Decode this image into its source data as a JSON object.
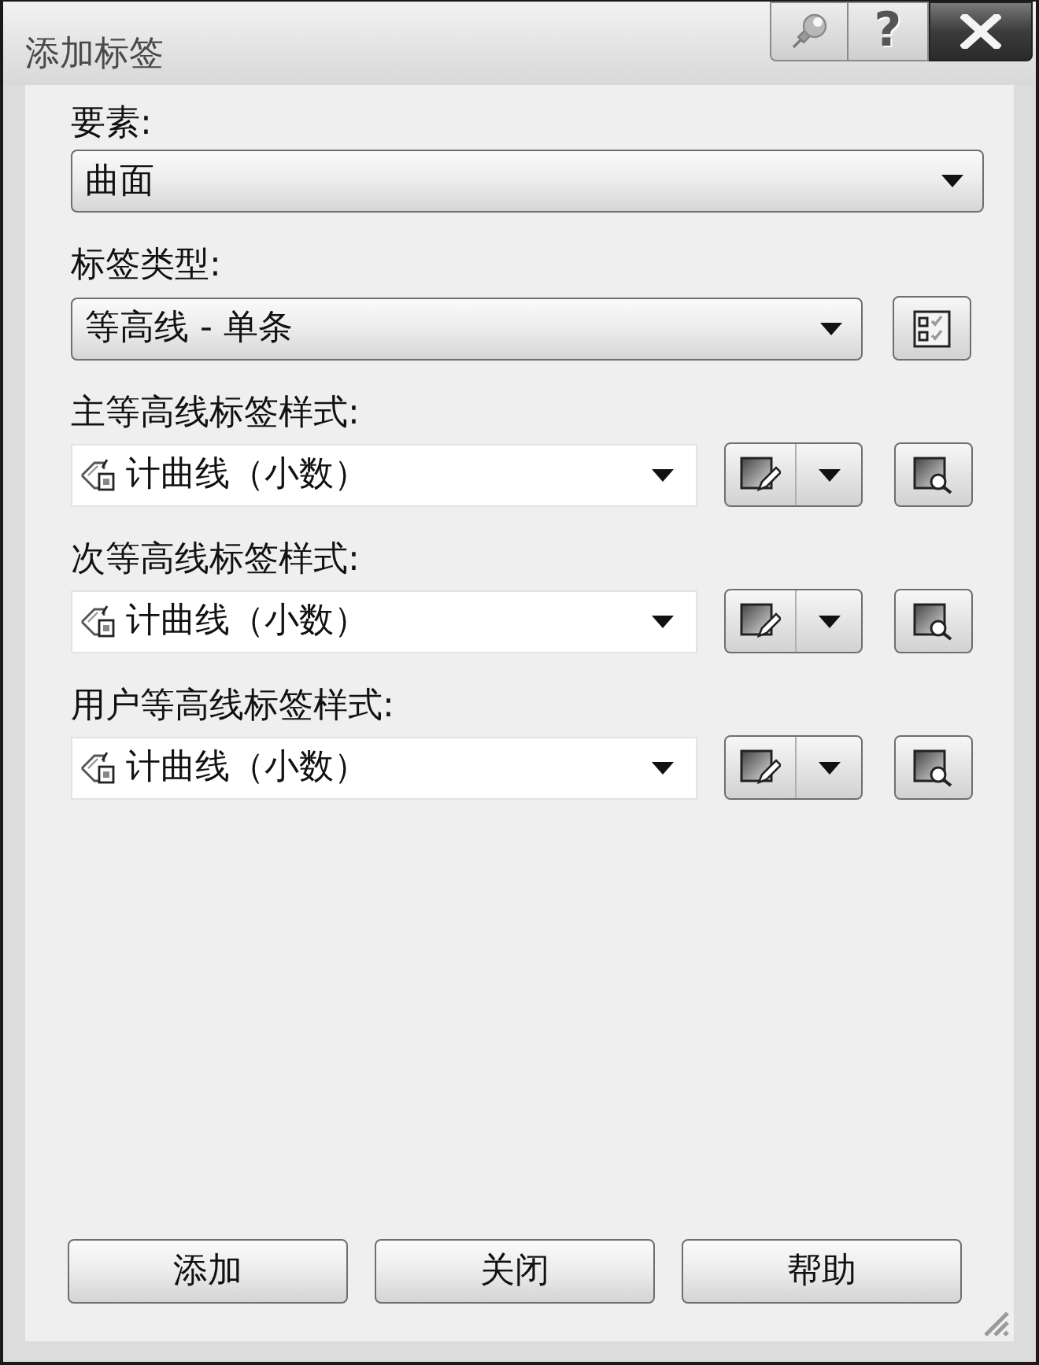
{
  "window": {
    "title": "添加标签",
    "help_glyph": "?"
  },
  "fields": [
    {
      "kind": "combo",
      "label": "要素:",
      "value": "曲面"
    },
    {
      "kind": "combo_button",
      "label": "标签类型:",
      "value": "等高线 - 单条"
    },
    {
      "kind": "style",
      "label": "主等高线标签样式:",
      "value": "计曲线（小数）"
    },
    {
      "kind": "style",
      "label": "次等高线标签样式:",
      "value": "计曲线（小数）"
    },
    {
      "kind": "style",
      "label": "用户等高线标签样式:",
      "value": "计曲线（小数）"
    }
  ],
  "buttons": [
    "添加",
    "关闭",
    "帮助"
  ]
}
